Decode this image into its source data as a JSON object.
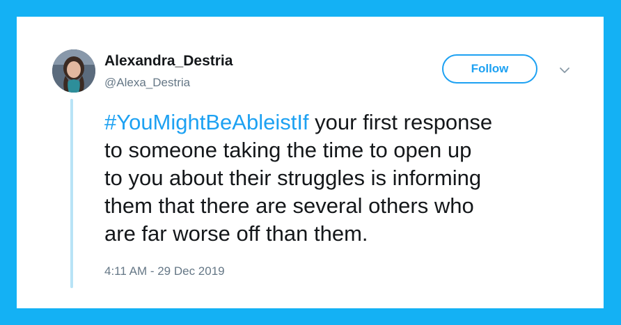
{
  "tweet": {
    "display_name": "Alexandra_Destria",
    "handle": "@Alexa_Destria",
    "follow_label": "Follow",
    "hashtag": "#YouMightBeAbleistIf",
    "lines": [
      " your first response",
      "to someone taking the time to open up",
      "to you about their struggles is informing",
      "them that there are several others who",
      "are far worse off than them."
    ],
    "timestamp": "4:11 AM - 29 Dec 2019"
  },
  "icons": {
    "more": "chevron-down-icon",
    "avatar": "user-avatar"
  },
  "colors": {
    "background": "#14b1f4",
    "card": "#ffffff",
    "accent": "#1da1f2",
    "text": "#14171a",
    "muted": "#657786",
    "thread_line": "#b8e3f6"
  }
}
